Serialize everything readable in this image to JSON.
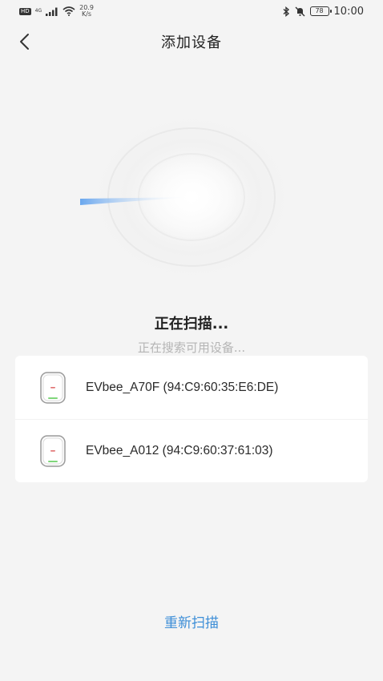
{
  "status_bar": {
    "chip": "HD",
    "network": "4G",
    "speed_value": "20.9",
    "speed_unit": "K/s",
    "battery": "78",
    "time": "10:00"
  },
  "header": {
    "title": "添加设备"
  },
  "scan": {
    "title": "正在扫描...",
    "subtitle": "正在搜索可用设备..."
  },
  "devices": [
    {
      "label": "EVbee_A70F (94:C9:60:35:E6:DE)"
    },
    {
      "label": "EVbee_A012 (94:C9:60:37:61:03)"
    }
  ],
  "actions": {
    "rescan_label": "重新扫描"
  },
  "colors": {
    "accent": "#3d8ed7",
    "background": "#f4f4f4",
    "card": "#ffffff",
    "device_led": "#7fd67a"
  }
}
